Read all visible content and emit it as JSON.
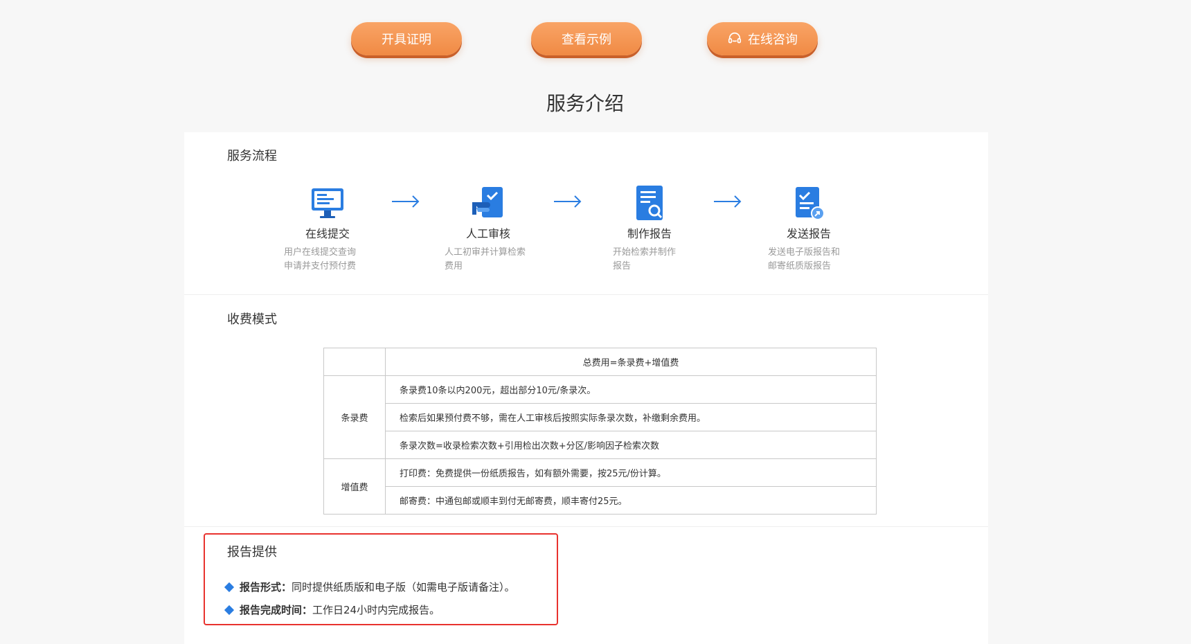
{
  "buttons": {
    "certificate": "开具证明",
    "example": "查看示例",
    "consult": "在线咨询"
  },
  "section_title": "服务介绍",
  "flow": {
    "heading": "服务流程",
    "steps": [
      {
        "name": "在线提交",
        "desc1": "用户在线提交查询",
        "desc2": "申请并支付预付费",
        "icon": "monitor-icon"
      },
      {
        "name": "人工审核",
        "desc1": "人工初审并计算检索",
        "desc2": "费用",
        "icon": "hand-check-icon"
      },
      {
        "name": "制作报告",
        "desc1": "开始检索并制作",
        "desc2": "报告",
        "icon": "document-search-icon"
      },
      {
        "name": "发送报告",
        "desc1": "发送电子版报告和",
        "desc2": "邮寄纸质版报告",
        "icon": "document-send-icon"
      }
    ]
  },
  "fees": {
    "heading": "收费模式",
    "table_header": "总费用=条录费+增值费",
    "record_label": "条录费",
    "record_rows": [
      "条录费10条以内200元，超出部分10元/条录次。",
      "检索后如果预付费不够，需在人工审核后按照实际条录次数，补缴剩余费用。",
      "条录次数=收录检索次数+引用检出次数+分区/影响因子检索次数"
    ],
    "value_label": "增值费",
    "value_rows": [
      "打印费：免费提供一份纸质报告，如有额外需要，按25元/份计算。",
      "邮寄费：中通包邮或顺丰到付无邮寄费，顺丰寄付25元。"
    ]
  },
  "report": {
    "heading": "报告提供",
    "format_label": "报告形式：",
    "format_value": "同时提供纸质版和电子版（如需电子版请备注）。",
    "time_label": "报告完成时间：",
    "time_value": "工作日24小时内完成报告。"
  },
  "colors": {
    "accent_orange": "#f08a44",
    "accent_blue": "#2a7de1",
    "highlight_red": "#e8322e"
  }
}
